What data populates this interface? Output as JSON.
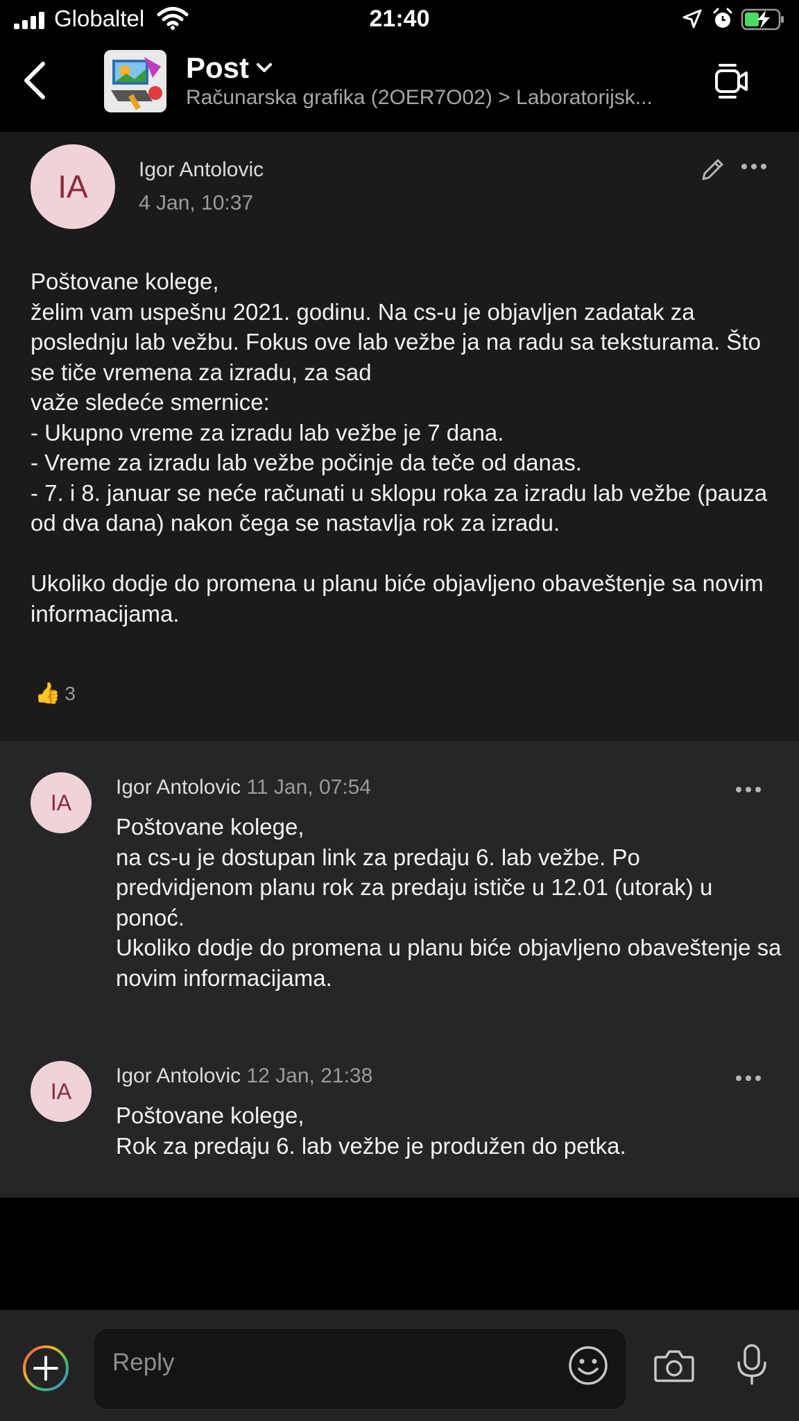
{
  "status_bar": {
    "carrier": "Globaltel",
    "time": "21:40"
  },
  "header": {
    "title": "Post",
    "breadcrumb": "Računarska grafika (2OER7O02) > Laboratorijsk..."
  },
  "post": {
    "avatar_initials": "IA",
    "author": "Igor Antolovic",
    "date": "4 Jan, 10:37",
    "body": "Poštovane kolege,\nželim vam uspešnu 2021. godinu. Na cs-u je objavljen zadatak za poslednju lab vežbu. Fokus ove lab vežbe ja na radu sa teksturama. Što se tiče vremena za izradu, za sad\nvaže sledeće smernice:\n- Ukupno vreme za izradu lab vežbe je 7 dana.\n- Vreme za izradu lab vežbe počinje da teče od danas.\n- 7. i 8. januar se neće računati u sklopu roka za izradu lab vežbe (pauza od dva dana) nakon čega se nastavlja rok za izradu.\n\nUkoliko dodje do promena u planu biće objavljeno obaveštenje sa novim informacijama.",
    "reaction_count": "3"
  },
  "replies": [
    {
      "avatar_initials": "IA",
      "author": "Igor Antolovic",
      "date": "11 Jan, 07:54",
      "body": "Poštovane kolege,\nna cs-u je dostupan link za predaju 6. lab vežbe. Po predvidjenom planu rok za predaju ističe u 12.01 (utorak) u ponoć.\nUkoliko dodje do promena u planu biće objavljeno obaveštenje sa novim informacijama."
    },
    {
      "avatar_initials": "IA",
      "author": "Igor Antolovic",
      "date": "12 Jan, 21:38",
      "body": "Poštovane kolege,\nRok za predaju 6. lab vežbe je produžen do petka."
    }
  ],
  "composer": {
    "placeholder": "Reply"
  },
  "colors": {
    "avatar_bg": "#f0d3d8",
    "avatar_text": "#8b2a3c",
    "battery_green": "#4cd964"
  }
}
